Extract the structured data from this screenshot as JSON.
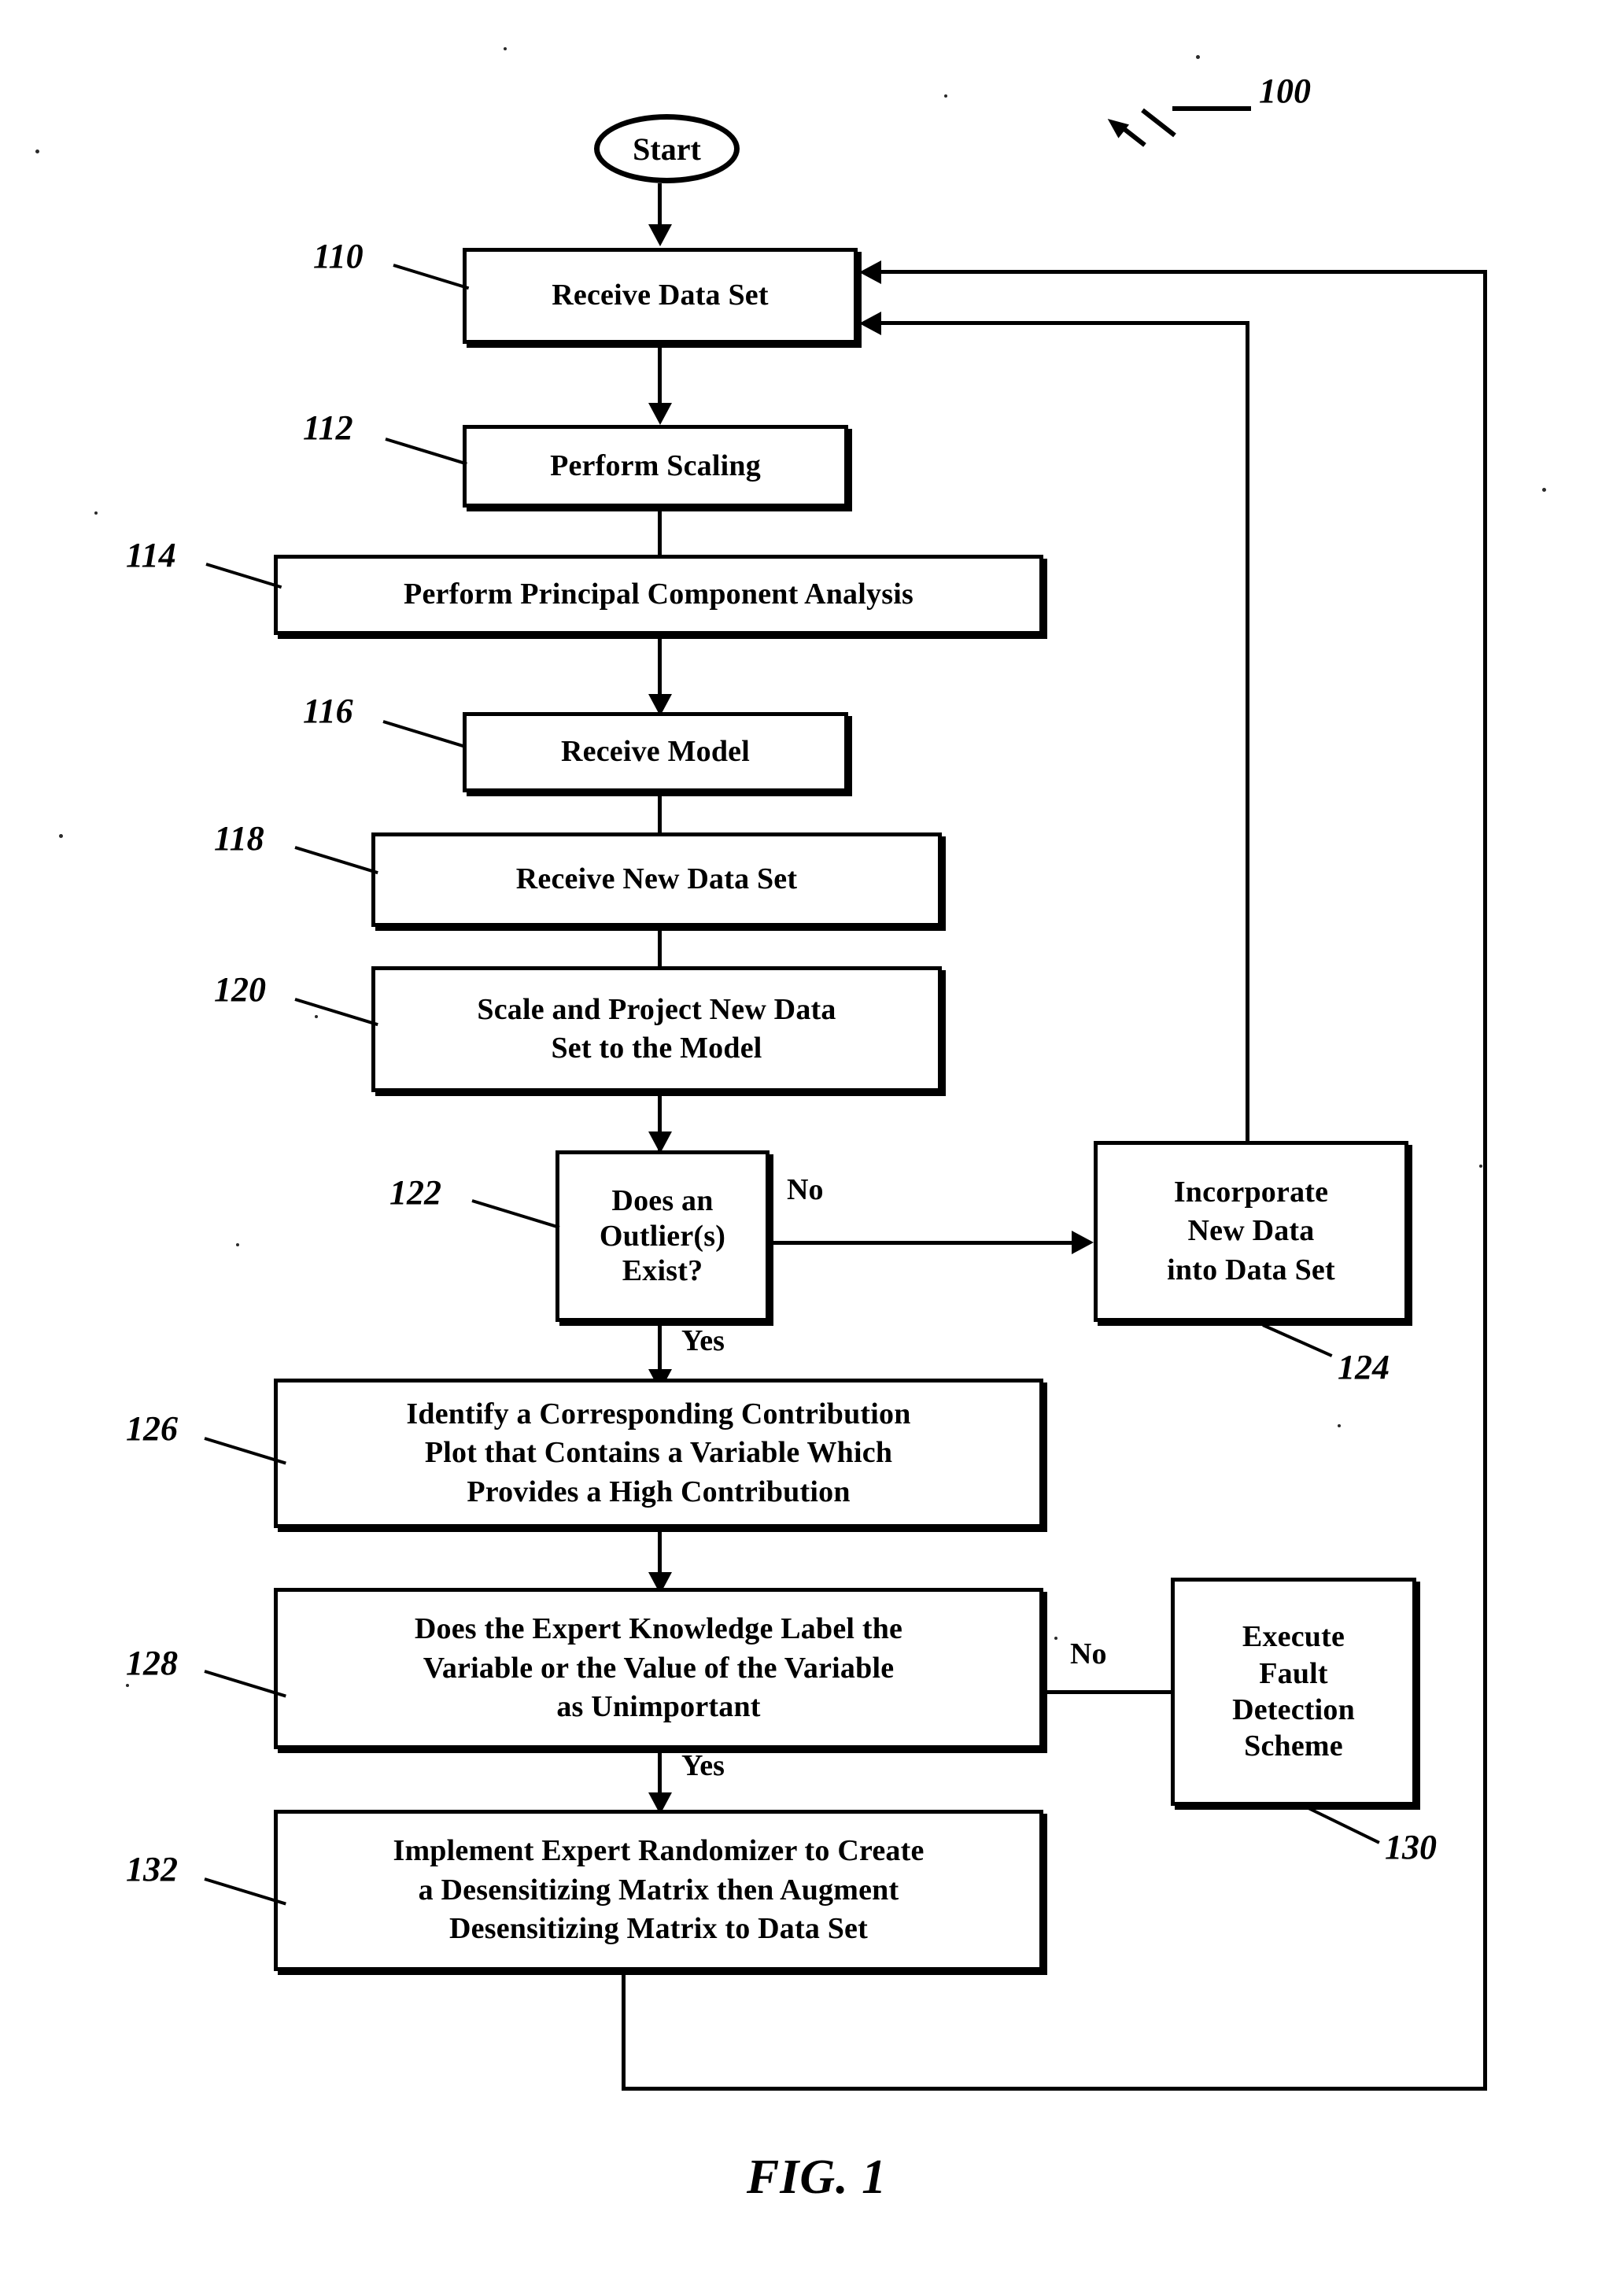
{
  "figure": {
    "caption": "FIG. 1",
    "system_ref": "100"
  },
  "nodes": [
    {
      "id": "start",
      "ref": "",
      "label": "Start",
      "lines": [
        "Start"
      ]
    },
    {
      "id": "n110",
      "ref": "110",
      "label": "Receive Data Set",
      "lines": [
        "Receive Data Set"
      ]
    },
    {
      "id": "n112",
      "ref": "112",
      "label": "Perform Scaling",
      "lines": [
        "Perform Scaling"
      ]
    },
    {
      "id": "n114",
      "ref": "114",
      "label": "Perform Principal Component Analysis",
      "lines": [
        "Perform Principal Component Analysis"
      ]
    },
    {
      "id": "n116",
      "ref": "116",
      "label": "Receive Model",
      "lines": [
        "Receive Model"
      ]
    },
    {
      "id": "n118",
      "ref": "118",
      "label": "Receive New Data Set",
      "lines": [
        "Receive New Data Set"
      ]
    },
    {
      "id": "n120",
      "ref": "120",
      "label": "Scale and Project New Data Set to the Model",
      "lines": [
        "Scale and Project New Data",
        "Set to the Model"
      ]
    },
    {
      "id": "n122",
      "ref": "122",
      "label": "Does an Outlier(s) Exist?",
      "lines": [
        "Does an",
        "Outlier(s)",
        "Exist?"
      ]
    },
    {
      "id": "n124",
      "ref": "124",
      "label": "Incorporate New Data into Data Set",
      "lines": [
        "Incorporate",
        "New Data",
        "into Data Set"
      ]
    },
    {
      "id": "n126",
      "ref": "126",
      "label": "Identify a Corresponding Contribution Plot that Contains a Variable Which Provides a High Contribution",
      "lines": [
        "Identify a Corresponding Contribution",
        "Plot that Contains a Variable Which",
        "Provides a High Contribution"
      ]
    },
    {
      "id": "n128",
      "ref": "128",
      "label": "Does the Expert Knowledge Label the Variable or the Value of the Variable as Unimportant",
      "lines": [
        "Does the Expert Knowledge Label the",
        "Variable or the Value of the Variable",
        "as Unimportant"
      ]
    },
    {
      "id": "n130",
      "ref": "130",
      "label": "Execute Fault Detection Scheme",
      "lines": [
        "Execute",
        "Fault",
        "Detection",
        "Scheme"
      ]
    },
    {
      "id": "n132",
      "ref": "132",
      "label": "Implement Expert Randomizer to Create a Desensitizing Matrix then Augment Desensitizing Matrix to Data Set",
      "lines": [
        "Implement Expert Randomizer to Create",
        "a Desensitizing Matrix then Augment",
        "Desensitizing Matrix to Data Set"
      ]
    }
  ],
  "edge_labels": {
    "outlier_no": "No",
    "outlier_yes": "Yes",
    "expert_no": "No",
    "expert_yes": "Yes"
  },
  "colors": {
    "ink": "#000000",
    "paper": "#ffffff"
  }
}
